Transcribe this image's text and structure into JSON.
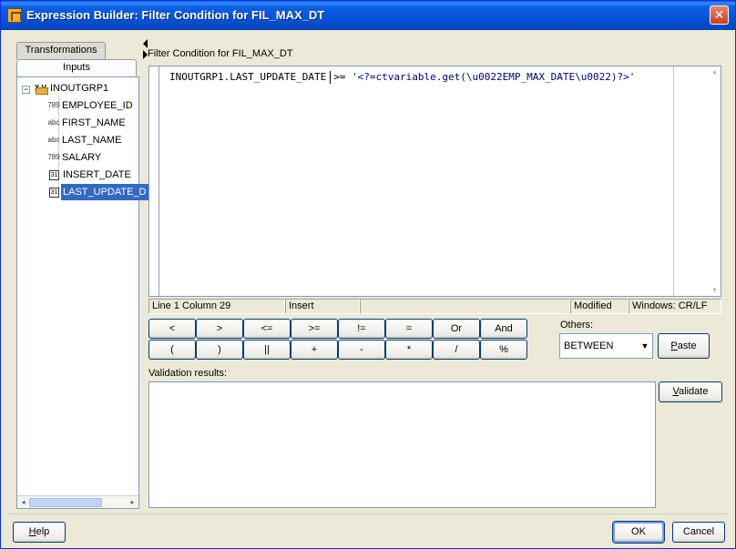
{
  "window": {
    "title": "Expression Builder: Filter Condition for FIL_MAX_DT",
    "close_glyph": "✕"
  },
  "left_panel": {
    "tabs": [
      {
        "label": "Transformations"
      },
      {
        "label": "Inputs"
      }
    ],
    "tree": {
      "expander": "−",
      "root": {
        "label": "INOUTGRP1",
        "icon": "group-xv-icon",
        "icon_text": "X.V"
      },
      "items": [
        {
          "label": "EMPLOYEE_ID",
          "icon": "numeric-type-icon",
          "icon_text": "789"
        },
        {
          "label": "FIRST_NAME",
          "icon": "string-type-icon",
          "icon_text": "abc"
        },
        {
          "label": "LAST_NAME",
          "icon": "string-type-icon",
          "icon_text": "abc"
        },
        {
          "label": "SALARY",
          "icon": "numeric-type-icon",
          "icon_text": "789"
        },
        {
          "label": "INSERT_DATE",
          "icon": "calendar-icon",
          "icon_text": "31"
        },
        {
          "label": "LAST_UPDATE_D",
          "icon": "calendar-icon",
          "icon_text": "31",
          "selected": true
        }
      ]
    },
    "scroll_left": "◂",
    "scroll_right": "▸"
  },
  "editor": {
    "label": "Filter Condition for FIL_MAX_DT",
    "code_identifier": "INOUTGRP1.LAST_UPDATE_DATE",
    "code_operator": ">=",
    "code_string": "'<?=ctvariable.get(\\u0022EMP_MAX_DATE\\u0022)?>'",
    "scroll_up": "▴",
    "scroll_down": "▾"
  },
  "status": {
    "position": "Line 1 Column 29",
    "mode": "Insert",
    "middle": "",
    "modified": "Modified",
    "line_endings": "Windows: CR/LF"
  },
  "operators": {
    "row1": [
      "<",
      ">",
      "<=",
      ">=",
      "!=",
      "=",
      "Or",
      "And"
    ],
    "row2": [
      "(",
      ")",
      "||",
      "+",
      "-",
      "*",
      "/",
      "%"
    ]
  },
  "others": {
    "label": "Others:",
    "selected": "BETWEEN",
    "dropdown_glyph": "▼",
    "paste_label": "Paste",
    "paste_mnemonic": "P"
  },
  "validation": {
    "label": "Validation results:",
    "validate_label": "Validate",
    "validate_mnemonic": "V"
  },
  "footer": {
    "help_label": "Help",
    "help_mnemonic": "H",
    "ok_label": "OK",
    "cancel_label": "Cancel"
  }
}
